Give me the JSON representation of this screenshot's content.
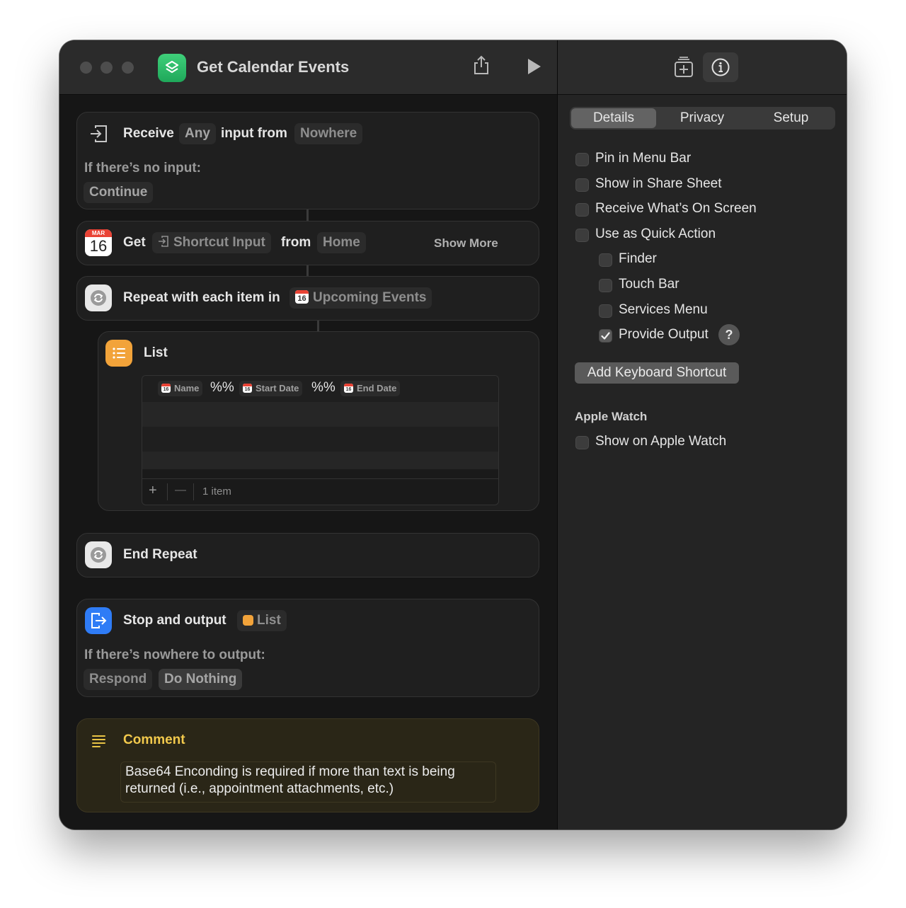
{
  "window": {
    "title": "Get Calendar Events"
  },
  "actions": {
    "receive": {
      "label": "Receive",
      "type_token": "Any",
      "mid": "input from",
      "source_token": "Nowhere",
      "no_input_label": "If there’s no input:",
      "no_input_option": "Continue"
    },
    "get": {
      "label": "Get",
      "input_token": "Shortcut Input",
      "from_label": "from",
      "from_token": "Home",
      "show_more": "Show More",
      "cal_month": "MAR",
      "cal_day": "16"
    },
    "repeat": {
      "label": "Repeat with each item in",
      "items_token": "Upcoming Events"
    },
    "list": {
      "label": "List",
      "item_template": [
        {
          "kind": "var",
          "text": "Name"
        },
        {
          "kind": "text",
          "text": "%%"
        },
        {
          "kind": "var",
          "text": "Start Date"
        },
        {
          "kind": "text",
          "text": "%%"
        },
        {
          "kind": "var",
          "text": "End Date"
        }
      ],
      "add": "+",
      "remove": "—",
      "count": "1 item"
    },
    "end_repeat": {
      "label": "End Repeat"
    },
    "stop_output": {
      "label": "Stop and output",
      "token": "List",
      "nowhere_label": "If there’s nowhere to output:",
      "options": [
        "Respond",
        "Do Nothing"
      ]
    },
    "comment": {
      "label": "Comment",
      "text": "Base64 Enconding is required if more than text is being returned (i.e., appointment attachments, etc.)"
    }
  },
  "inspector": {
    "tabs": [
      "Details",
      "Privacy",
      "Setup"
    ],
    "active_tab": "Details",
    "options": [
      {
        "label": "Pin in Menu Bar",
        "checked": false,
        "indent": 0
      },
      {
        "label": "Show in Share Sheet",
        "checked": false,
        "indent": 0
      },
      {
        "label": "Receive What’s On Screen",
        "checked": false,
        "indent": 0
      },
      {
        "label": "Use as Quick Action",
        "checked": false,
        "indent": 0
      },
      {
        "label": "Finder",
        "checked": false,
        "indent": 1
      },
      {
        "label": "Touch Bar",
        "checked": false,
        "indent": 1
      },
      {
        "label": "Services Menu",
        "checked": false,
        "indent": 1
      },
      {
        "label": "Provide Output",
        "checked": true,
        "indent": 1
      }
    ],
    "help": "?",
    "keyboard_button": "Add Keyboard Shortcut",
    "watch_section": "Apple Watch",
    "watch_option": {
      "label": "Show on Apple Watch",
      "checked": false
    }
  }
}
